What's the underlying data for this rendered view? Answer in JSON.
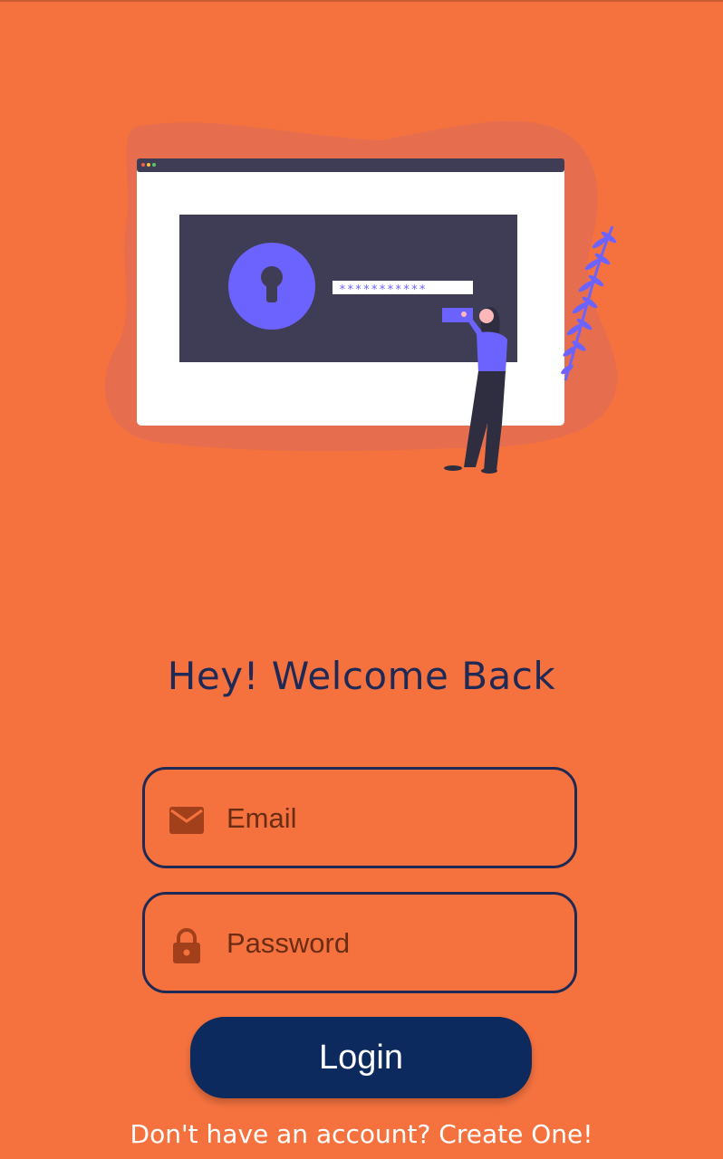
{
  "screen": {
    "title": "Hey! Welcome Back",
    "background_color": "#F5723F",
    "accent_color": "#0C2A5E"
  },
  "illustration": {
    "name": "login-illustration",
    "masked_password": "***********"
  },
  "form": {
    "email": {
      "placeholder": "Email",
      "value": "",
      "icon": "mail-icon"
    },
    "password": {
      "placeholder": "Password",
      "value": "",
      "icon": "lock-icon"
    },
    "login_label": "Login"
  },
  "footer": {
    "prompt": "Don't have an account?",
    "link": "Create One!"
  }
}
